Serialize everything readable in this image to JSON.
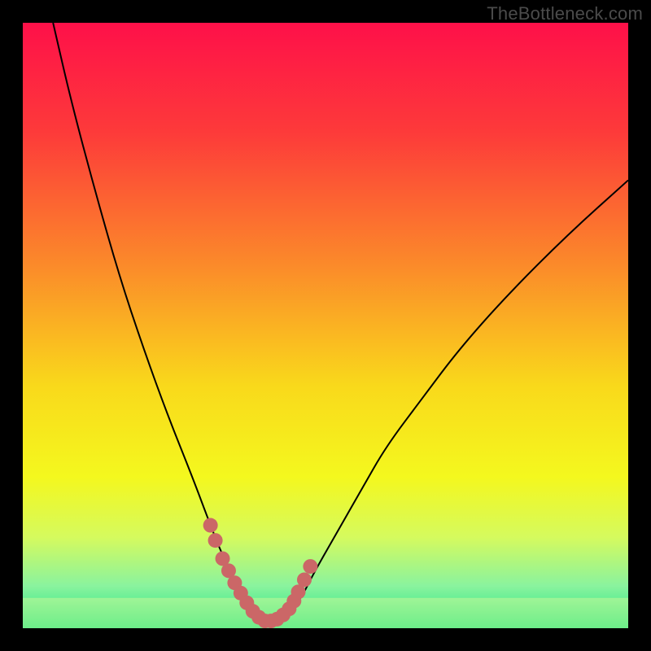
{
  "attribution": "TheBottleneck.com",
  "colors": {
    "frame": "#000000",
    "gradient_stops": [
      {
        "offset": 0.0,
        "color": "#fe1049"
      },
      {
        "offset": 0.18,
        "color": "#fd3a3a"
      },
      {
        "offset": 0.4,
        "color": "#fb8a2a"
      },
      {
        "offset": 0.6,
        "color": "#f9d91b"
      },
      {
        "offset": 0.75,
        "color": "#f4f81e"
      },
      {
        "offset": 0.85,
        "color": "#d5fa5e"
      },
      {
        "offset": 0.93,
        "color": "#8af39e"
      },
      {
        "offset": 1.0,
        "color": "#1fe583"
      }
    ],
    "curve": "#000000",
    "marker": "#cb6767",
    "acceptable_overlay": "#ffff99",
    "acceptable_overlay_opacity": 0.35
  },
  "chart_data": {
    "type": "line",
    "title": "",
    "xlabel": "",
    "ylabel": "",
    "xlim": [
      0,
      100
    ],
    "ylim": [
      0,
      100
    ],
    "grid": false,
    "legend": false,
    "acceptable_band": {
      "y_min": 0,
      "y_max": 5
    },
    "series": [
      {
        "name": "bottleneck-curve",
        "x": [
          5,
          8,
          12,
          16,
          20,
          24,
          28,
          31,
          33,
          35,
          37,
          38,
          39,
          40,
          41,
          42,
          43,
          44,
          46,
          48,
          52,
          56,
          60,
          66,
          72,
          80,
          90,
          100
        ],
        "y": [
          100,
          87,
          72,
          58,
          46,
          35,
          25,
          17,
          12,
          8,
          5,
          3,
          1.5,
          1,
          1,
          1,
          1.5,
          2.5,
          5,
          9,
          16,
          23,
          30,
          38,
          46,
          55,
          65,
          74
        ]
      }
    ],
    "markers": {
      "name": "highlight-points",
      "x": [
        31.0,
        31.8,
        33.0,
        34.0,
        35.0,
        36.0,
        37.0,
        38.0,
        39.0,
        40.0,
        41.0,
        42.0,
        43.0,
        44.0,
        44.8,
        45.5,
        46.5,
        47.5
      ],
      "y": [
        17.0,
        14.5,
        11.5,
        9.5,
        7.5,
        5.8,
        4.2,
        2.8,
        1.8,
        1.2,
        1.2,
        1.5,
        2.2,
        3.2,
        4.5,
        6.0,
        8.0,
        10.2
      ]
    }
  }
}
